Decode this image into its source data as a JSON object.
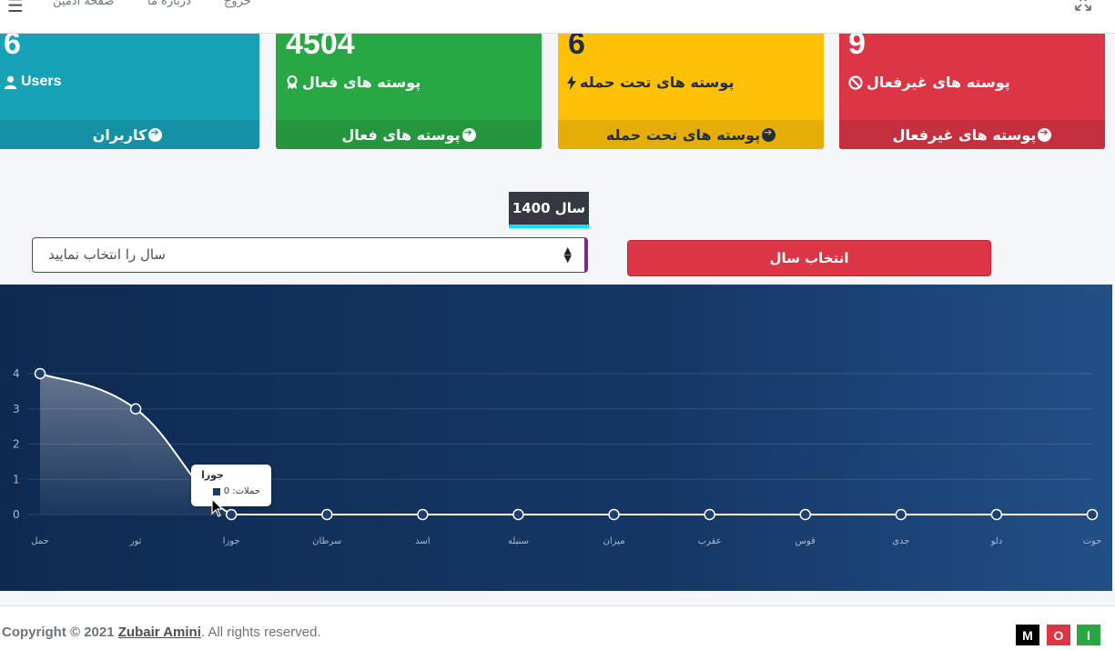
{
  "navbar": {
    "admin_page": "صفحه ادمین",
    "about": "درباره ما",
    "logout": "خروج"
  },
  "cards": [
    {
      "value": "6",
      "label": "Users",
      "footer": "کاربران",
      "color": "#17a2b8"
    },
    {
      "value": "4504",
      "label": "پوسته های فعال",
      "footer": "پوسته های فعال",
      "color": "#28a745"
    },
    {
      "value": "6",
      "label": "پوسته های تحت حمله",
      "footer": "پوسته های تحت حمله",
      "color": "#ffc107"
    },
    {
      "value": "9",
      "label": "پوسته های غیرفعال",
      "footer": "پوسته های غیرفعال",
      "color": "#dc3545"
    }
  ],
  "year_badge": "سال 1400",
  "year_select": {
    "placeholder": "سال را انتخاب نمایید"
  },
  "select_button": "انتخاب سال",
  "chart_data": {
    "type": "area",
    "categories": [
      "حمل",
      "ثور",
      "جوزا",
      "سرطان",
      "اسد",
      "سنبله",
      "میزان",
      "عقرب",
      "قوس",
      "جدی",
      "دلو",
      "حوت"
    ],
    "y_ticks": [
      "0",
      "1",
      "2",
      "3",
      "4"
    ],
    "ylim": [
      0,
      4
    ],
    "series": [
      {
        "values": [
          4,
          3,
          0,
          0,
          0,
          0,
          0,
          0,
          0,
          0,
          0,
          0
        ]
      }
    ],
    "grid": true,
    "tooltip": {
      "title": "جوزا",
      "text": "حملات: 0"
    }
  },
  "footer": {
    "copyright_prefix": "Copyright © 2021",
    "author": "Zubair Amini",
    "suffix": ". All rights reserved.",
    "badges": [
      {
        "letter": "M",
        "color": "#000000"
      },
      {
        "letter": "O",
        "color": "#dc3545"
      },
      {
        "letter": "I",
        "color": "#28a745"
      }
    ]
  }
}
